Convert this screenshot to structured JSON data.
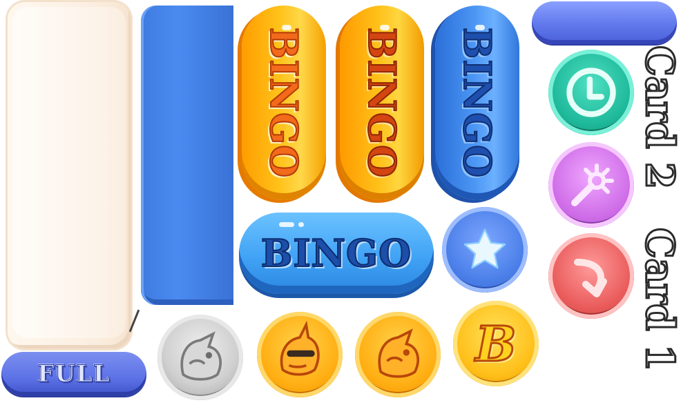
{
  "buttons": {
    "full_label": "FULL",
    "bingo_yellow_1": "BINGO",
    "bingo_yellow_2": "BINGO",
    "bingo_blue_vertical": "BINGO",
    "bingo_blue_horizontal": "BINGO"
  },
  "cards": {
    "card_2": "Card 2",
    "card_1": "Card 1"
  },
  "tokens": {
    "b_coin": "B"
  },
  "icons": [
    "star-icon",
    "clock-icon",
    "magic-wand-icon",
    "curved-arrow-icon",
    "rhino-face-icon",
    "unicorn-sunglasses-icon",
    "dragon-face-icon"
  ],
  "colors": {
    "cream": "#fbeee0",
    "panel_blue": "#4a8bf0",
    "bingo_yellow": "#ffc21a",
    "bingo_blue": "#4a95f3",
    "teal": "#1fb99b",
    "purple": "#cf6ee8",
    "red": "#ea5c5c",
    "gold": "#ffae12"
  }
}
